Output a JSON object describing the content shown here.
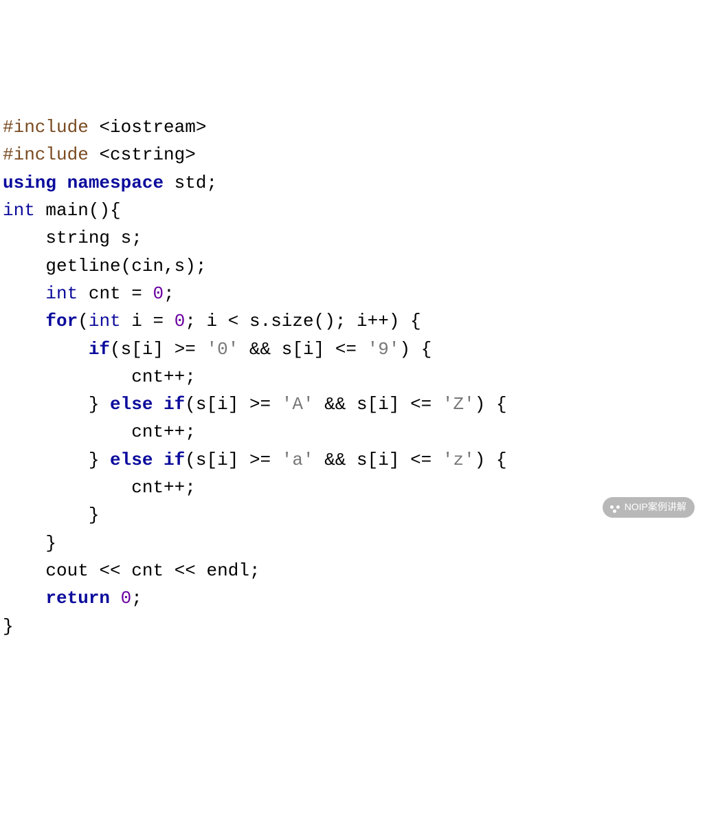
{
  "code": {
    "t_include1": "#include",
    "t_hdr1": "iostream",
    "t_include2": "#include",
    "t_hdr2": "cstring",
    "t_using": "using",
    "t_namespace": "namespace",
    "t_std": "std",
    "t_int": "int",
    "t_main": "main",
    "t_string": "string",
    "t_s": "s",
    "t_getline": "getline",
    "t_cin": "cin",
    "t_cnt": "cnt",
    "t_for": "for",
    "t_i": "i",
    "t_size": "size",
    "t_if": "if",
    "t_else": "else",
    "t_zero": "0",
    "t_ch0": "'0'",
    "t_ch9": "'9'",
    "t_chA": "'A'",
    "t_chZ": "'Z'",
    "t_cha": "'a'",
    "t_chz": "'z'",
    "t_cout": "cout",
    "t_endl": "endl",
    "t_return": "return",
    "t_and": "&&",
    "t_le": "<=",
    "t_ge": ">=",
    "t_lt": "<",
    "t_eq": "=",
    "t_inc": "++",
    "t_semi": ";",
    "t_comma": ",",
    "t_dot": ".",
    "t_lbr": "{",
    "t_rbr": "}",
    "t_lpar": "(",
    "t_rpar": ")",
    "t_lsq": "[",
    "t_rsq": "]",
    "t_ltang": "<",
    "t_gtang": ">",
    "t_out": "<<"
  },
  "watermark": {
    "label": "NOIP案例讲解"
  }
}
